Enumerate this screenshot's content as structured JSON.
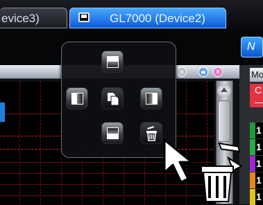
{
  "tabs": [
    {
      "label": "evice3)",
      "active": false
    },
    {
      "label": "GL7000 (Device2)",
      "active": true
    }
  ],
  "toolbar": {
    "right_button_label": "N"
  },
  "window": {
    "close_label": "×"
  },
  "side_list": {
    "header": "Mo",
    "red_char": "C",
    "red_dash": "—",
    "rows": [
      {
        "num": "1",
        "color": "#1f9a3a"
      },
      {
        "num": "1",
        "color": "#2aa84a"
      },
      {
        "num": "1",
        "color": "#9a2ad0"
      },
      {
        "num": "1",
        "color": "#e08a1a"
      },
      {
        "num": "1",
        "color": "#e0c21a"
      }
    ]
  },
  "popup": {
    "buttons": [
      {
        "name": "split-top-icon"
      },
      {
        "name": "split-left-icon"
      },
      {
        "name": "copy-icon"
      },
      {
        "name": "split-right-icon"
      },
      {
        "name": "split-bottom-icon"
      },
      {
        "name": "delete-trash-icon"
      }
    ]
  },
  "colors": {
    "active_tab": "#1e78e8",
    "popup_bg": "#0e0f12",
    "grid_red": "#e02020"
  }
}
